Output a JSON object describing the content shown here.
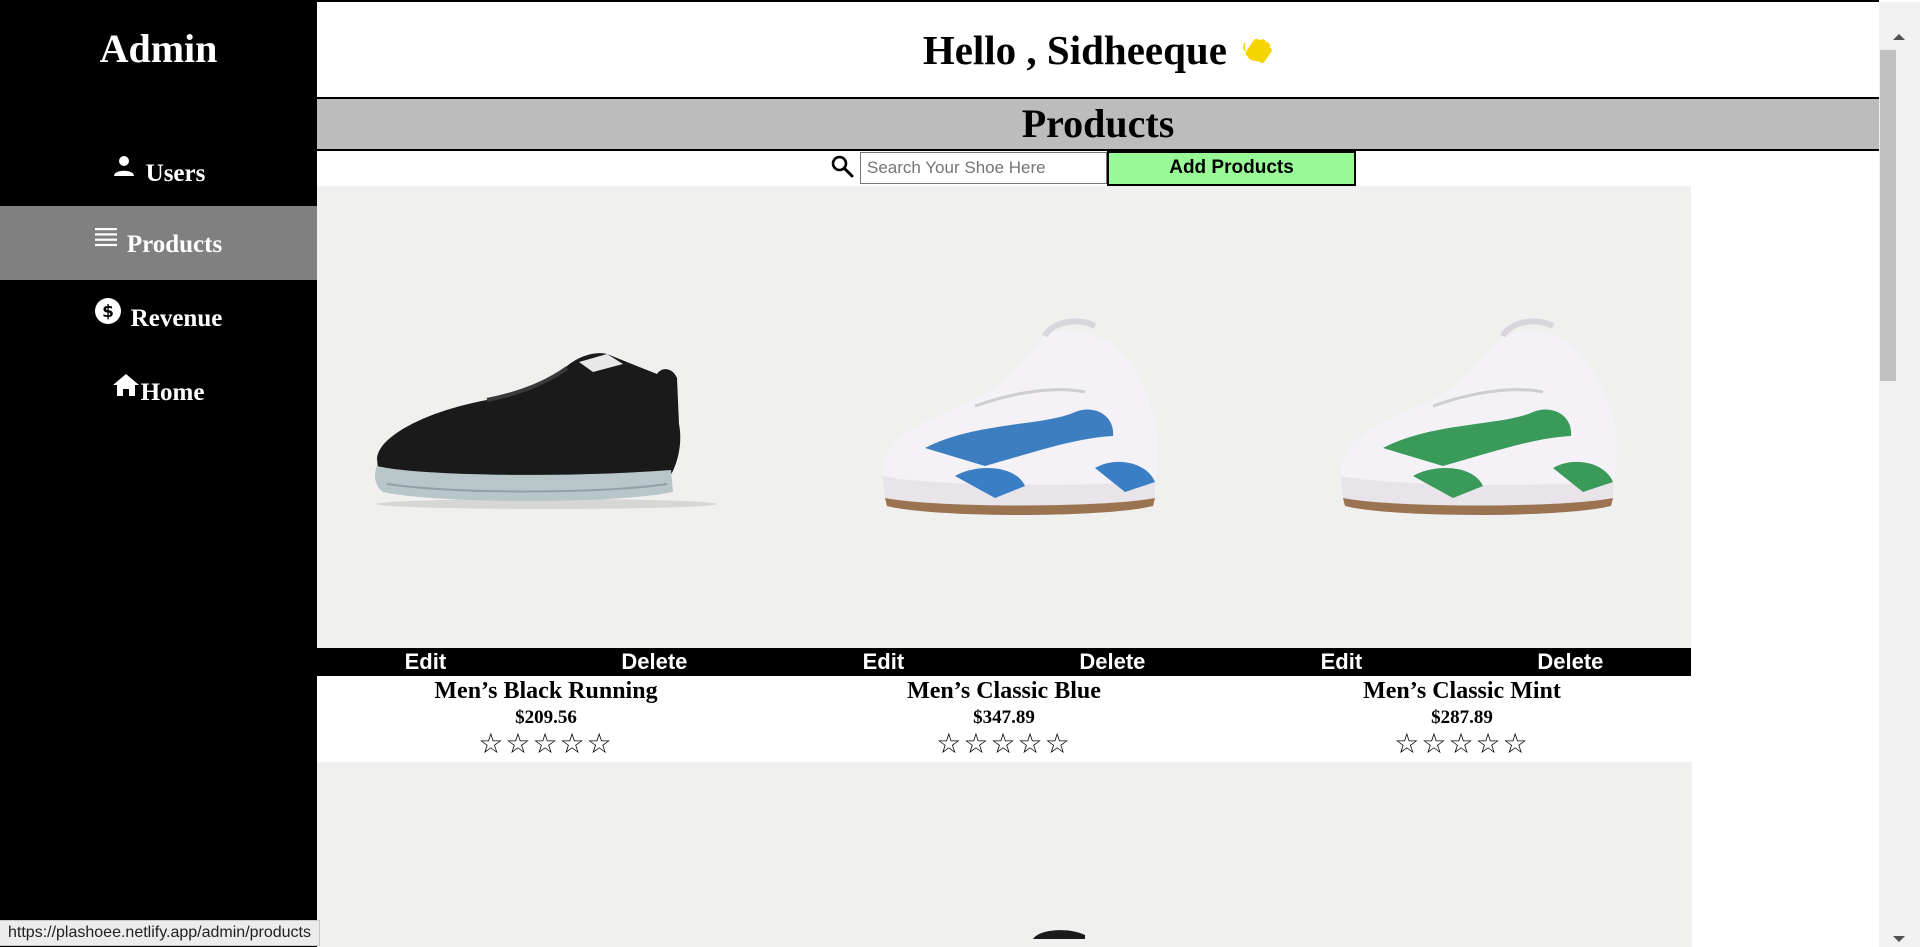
{
  "sidebar": {
    "brand": "Admin",
    "items": [
      {
        "label": "Users",
        "icon": "person-icon"
      },
      {
        "label": "Products",
        "icon": "list-icon",
        "active": true
      },
      {
        "label": "Revenue",
        "icon": "dollar-circle-icon"
      },
      {
        "label": "Home",
        "icon": "home-icon"
      }
    ]
  },
  "header": {
    "greeting": "Hello , Sidheeque",
    "greeting_icon": "waving-hand-icon",
    "section_title": "Products"
  },
  "toolbar": {
    "search_placeholder": "Search Your Shoe Here",
    "search_value": "",
    "add_label": "Add Products"
  },
  "products": [
    {
      "name": "Men’s Black Running",
      "price": "$209.56",
      "edit": "Edit",
      "delete": "Delete",
      "rating": 0,
      "stars": "☆☆☆☆☆"
    },
    {
      "name": "Men’s Classic Blue",
      "price": "$347.89",
      "edit": "Edit",
      "delete": "Delete",
      "rating": 0,
      "stars": "☆☆☆☆☆"
    },
    {
      "name": "Men’s Classic Mint",
      "price": "$287.89",
      "edit": "Edit",
      "delete": "Delete",
      "rating": 0,
      "stars": "☆☆☆☆☆"
    }
  ],
  "statusbar": {
    "url": "https://plashoee.netlify.app/admin/products"
  },
  "colors": {
    "sidebar_bg": "#000000",
    "active_item_bg": "#808080",
    "section_bar_bg": "#bcbcbc",
    "add_button_bg": "#98fb98",
    "card_image_bg": "#f0f0ef",
    "wave_icon": "#f5d400"
  }
}
